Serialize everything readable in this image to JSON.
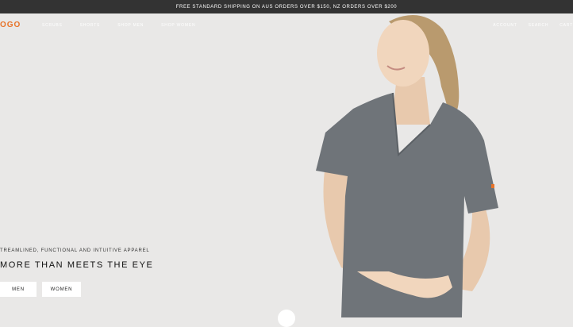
{
  "announcement": {
    "text": "FREE STANDARD SHIPPING ON AUS ORDERS OVER $150, NZ ORDERS OVER $200"
  },
  "brand": {
    "logo_text": "OGO",
    "accent": "#e8742a"
  },
  "nav": {
    "left_items": [
      "Scrubs",
      "Shorts",
      "Shop Men",
      "Shop Women"
    ],
    "right_items": [
      "Account",
      "Search",
      "Cart"
    ]
  },
  "hero": {
    "tagline": "TREAMLINED, FUNCTIONAL AND INTUITIVE APPAREL",
    "headline": "MORE THAN MEETS THE EYE",
    "buttons": {
      "men": "MEN",
      "women": "WOMEN"
    }
  }
}
